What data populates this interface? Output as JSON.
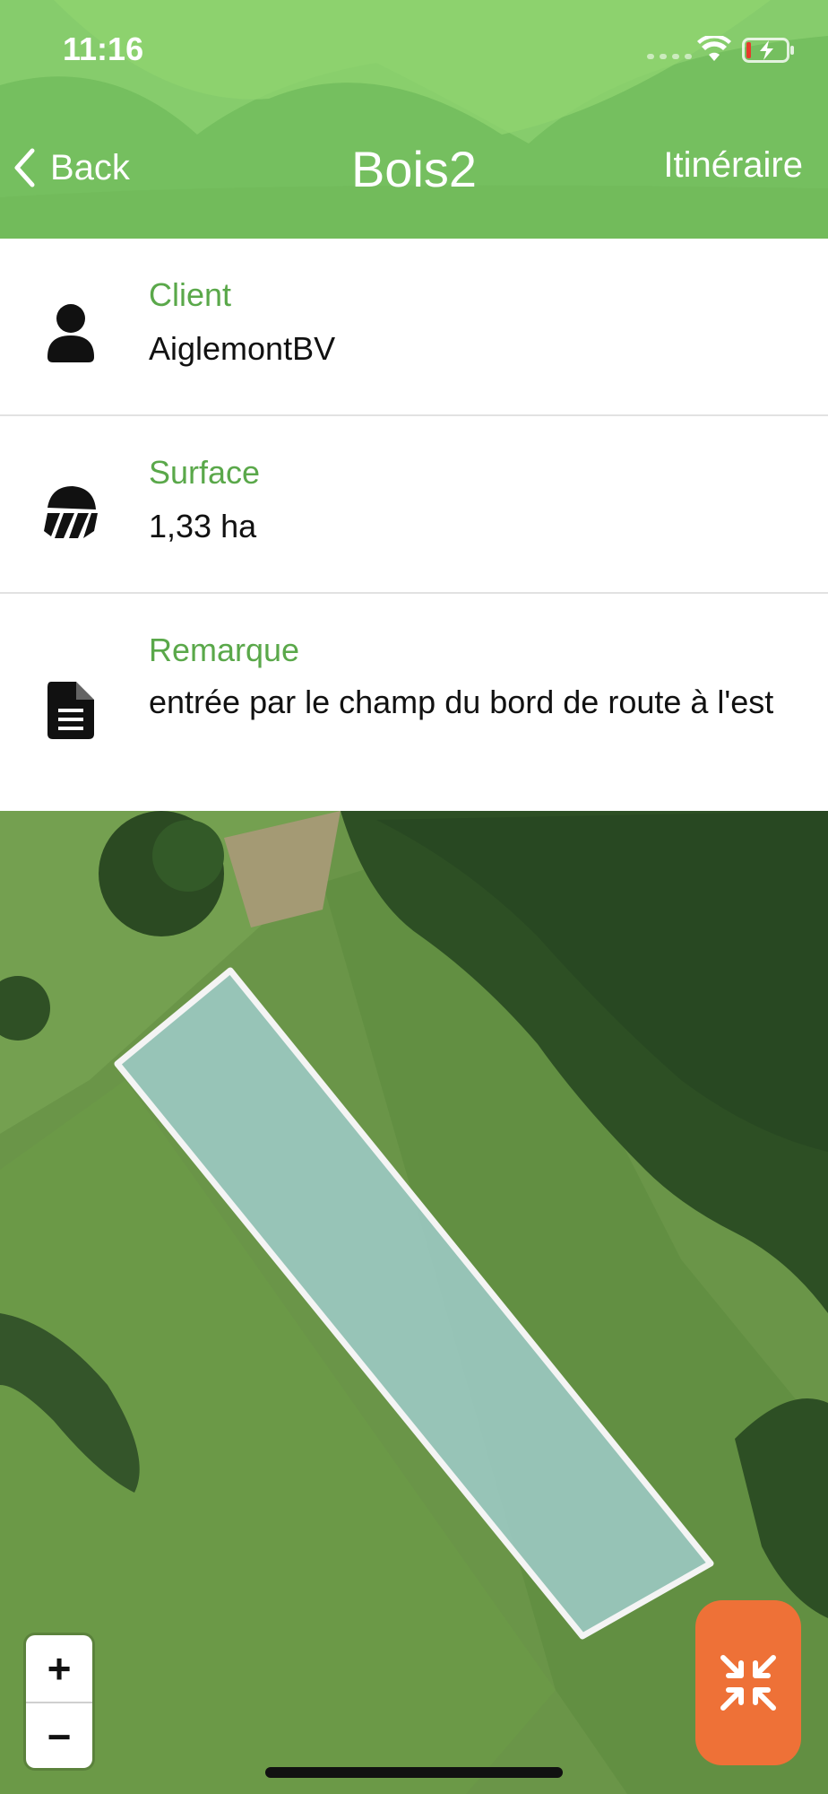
{
  "status_bar": {
    "time": "11:16"
  },
  "header": {
    "back_label": "Back",
    "title": "Bois2",
    "route_label": "Itinéraire"
  },
  "details": [
    {
      "label": "Client",
      "value": "AiglemontBV",
      "icon": "person-icon"
    },
    {
      "label": "Surface",
      "value": "1,33 ha",
      "icon": "surface-icon"
    },
    {
      "label": "Remarque",
      "value": "entrée par le champ du bord de route à l'est",
      "icon": "document-icon"
    }
  ],
  "map": {
    "zoom_in": "+",
    "zoom_out": "−",
    "collapse_icon": "collapse-arrows-icon"
  },
  "colors": {
    "header_green": "#77c161",
    "label_green": "#5aa84a",
    "action_orange": "#ee7137",
    "parcel_fill": "#9cc9c3"
  }
}
